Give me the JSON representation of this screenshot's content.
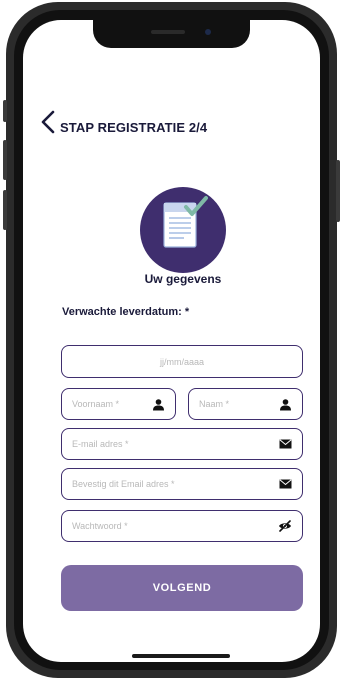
{
  "header": {
    "back_icon": "chevron-left-icon",
    "title": "STAP REGISTRATIE 2/4"
  },
  "profile": {
    "icon": "document-check-icon",
    "label": "Uw gegevens",
    "accent_color": "#3f2e6e",
    "check_color": "#7fb9a6"
  },
  "form": {
    "date_label": "Verwachte leverdatum: *",
    "date_placeholder": "jj/mm/aaaa",
    "firstname_placeholder": "Voornaam *",
    "lastname_placeholder": "Naam *",
    "email_placeholder": "E-mail adres *",
    "email_confirm_placeholder": "Bevestig dit Email adres *",
    "password_placeholder": "Wachtwoord *",
    "icons": {
      "firstname": "user-icon",
      "lastname": "user-icon",
      "email": "envelope-icon",
      "email_confirm": "envelope-icon",
      "password": "eye-off-icon"
    }
  },
  "actions": {
    "submit_label": "VOLGEND",
    "submit_color": "#7d6ba3"
  }
}
